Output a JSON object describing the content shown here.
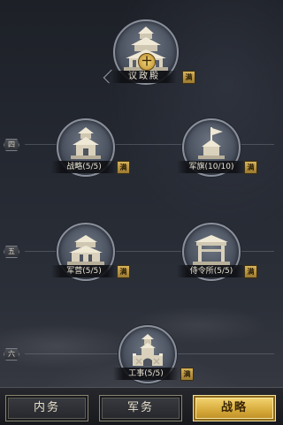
{
  "tiers": [
    {
      "label": "四"
    },
    {
      "label": "五"
    },
    {
      "label": "六"
    }
  ],
  "buildings": {
    "hall": {
      "name": "议政殿",
      "center_badge": "十",
      "full_label": "满"
    },
    "strategy": {
      "name": "战略(5/5)",
      "full_label": "满"
    },
    "banner": {
      "name": "军旗(10/10)",
      "full_label": "满"
    },
    "camp": {
      "name": "军营(5/5)",
      "full_label": "满"
    },
    "guard": {
      "name": "侍令所(5/5)",
      "full_label": "满"
    },
    "works": {
      "name": "工事(5/5)",
      "full_label": "满"
    }
  },
  "tabs": [
    {
      "label": "内务",
      "active": false
    },
    {
      "label": "军务",
      "active": false
    },
    {
      "label": "战略",
      "active": true
    }
  ],
  "colors": {
    "accent_gold": "#d6a93a",
    "plate_text": "#e8e2d0",
    "circle_rim": "#8a909b"
  }
}
